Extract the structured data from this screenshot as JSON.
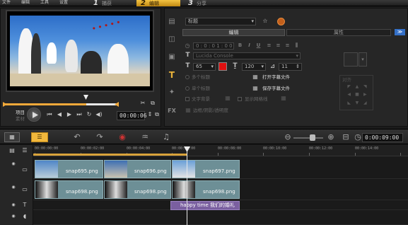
{
  "menu": {
    "file": "文件",
    "edit": "编辑",
    "tools": "工具",
    "settings": "设置"
  },
  "steps": [
    {
      "num": "1",
      "label": "捕获"
    },
    {
      "num": "2",
      "label": "编辑"
    },
    {
      "num": "3",
      "label": "分享"
    }
  ],
  "preview": {
    "project_label": "项目",
    "clip_label": "素材",
    "timecode": "00:00:06",
    "progress_fraction": 0.73
  },
  "options": {
    "preset_value": "标题",
    "tab_edit": "编辑",
    "tab_attributes": "属性",
    "duration_value": "0 : 0 : 0 1 : 0 0",
    "font_value": "Lucida Console",
    "size_value": "65",
    "color_value": "#e01010",
    "line_spacing_value": "120",
    "angle_value": "11",
    "open_subtitle": "打开字幕文件",
    "save_subtitle": "保存字幕文件",
    "radio_multi": "多个标题",
    "radio_single": "单个标题",
    "checkbox_bg": "文字背景",
    "checkbox_grid": "显示网格线",
    "border_label": "边框/阴影/透明度",
    "align_label": "对齐"
  },
  "timeline": {
    "timecode": "0:00:09:00",
    "ruler_ticks": [
      "00:00:00:00",
      "00:00:02:00",
      "00:00:04:00",
      "00:00:06:00",
      "00:00:08:00",
      "00:00:10:00",
      "00:00:12:00",
      "00:00:14:00"
    ],
    "video_track_1": [
      "snap695.png",
      "snap696.png",
      "snap697.png"
    ],
    "video_track_2": [
      "snap698.png",
      "snap698.png",
      "snap698.png"
    ],
    "title_clip": {
      "text1": "happy time",
      "text2": "我们的婚礼"
    }
  },
  "colors": {
    "accent": "#f2a93a",
    "tab_active": "#e6b13a",
    "clip": "#6d8f96",
    "title_clip": "#7a5fa0"
  }
}
